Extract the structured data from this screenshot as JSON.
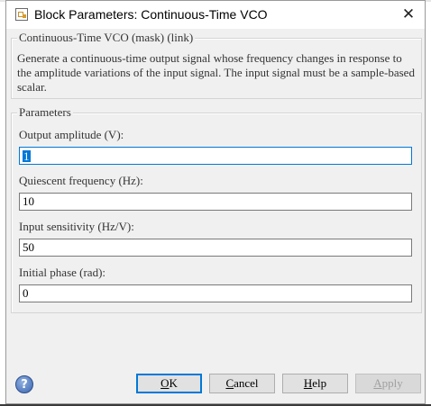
{
  "window": {
    "title": "Block Parameters: Continuous-Time VCO",
    "close_glyph": "✕"
  },
  "mask_group": {
    "label": "Continuous-Time VCO (mask) (link)",
    "description": "Generate a continuous-time output signal whose frequency changes in response to the amplitude variations of the input signal. The input signal must be a sample-based scalar."
  },
  "params_group": {
    "label": "Parameters",
    "fields": [
      {
        "label": "Output amplitude (V):",
        "value": "1"
      },
      {
        "label": "Quiescent frequency (Hz):",
        "value": "10"
      },
      {
        "label": "Input sensitivity (Hz/V):",
        "value": "50"
      },
      {
        "label": "Initial phase (rad):",
        "value": "0"
      }
    ]
  },
  "buttons": {
    "help_glyph": "?",
    "ok": {
      "first": "O",
      "rest": "K"
    },
    "cancel": {
      "first": "C",
      "rest": "ancel"
    },
    "help": {
      "first": "H",
      "rest": "elp"
    },
    "apply": {
      "first": "A",
      "rest": "pply"
    }
  },
  "colors": {
    "accent": "#0078d7",
    "window_bg": "#f0f0f0",
    "disabled_text": "#a0a0a0"
  }
}
